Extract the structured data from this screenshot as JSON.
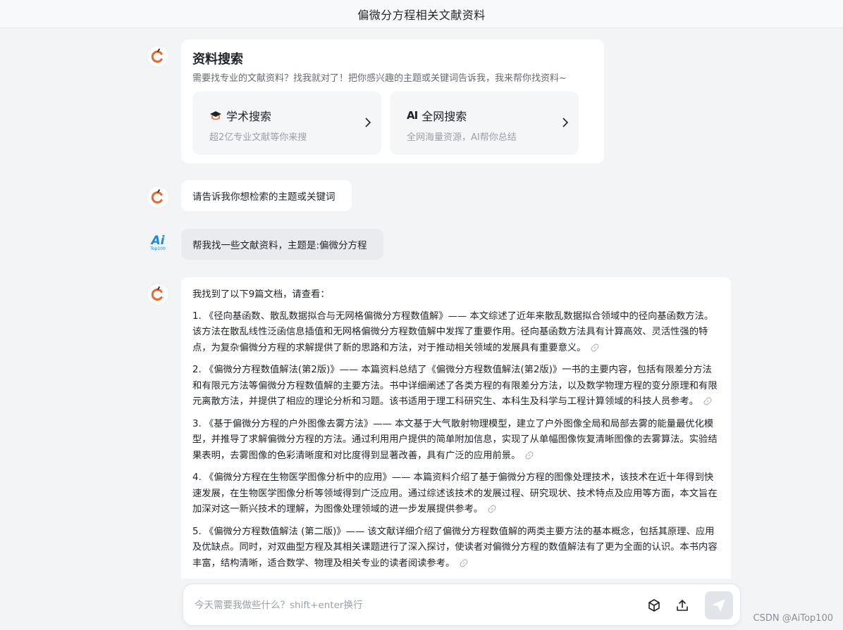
{
  "header": {
    "title": "偏微分方程相关文献资料"
  },
  "search_card": {
    "title": "资料搜索",
    "subtitle": "需要找专业的文献资料？找我就对了！把你感兴趣的主题或关键词告诉我，我来帮你找资料~",
    "options": [
      {
        "icon": "graduation-cap-icon",
        "title": "学术搜索",
        "desc": "超2亿专业文献等你来搜"
      },
      {
        "icon": "ai-icon",
        "icon_text": "AI",
        "title": "全网搜索",
        "desc": "全网海量资源，AI帮你总结"
      }
    ]
  },
  "messages": {
    "bot_prompt": "请告诉我你想检索的主题或关键词",
    "user_request": "帮我找一些文献资料，主题是:偏微分方程",
    "user_avatar_text": "Ai",
    "user_avatar_sub": "Top100"
  },
  "answer": {
    "intro": "我找到了以下9篇文档，请查看：",
    "items": [
      "1. 《径向基函数、散乱数据拟合与无网格偏微分方程数值解》—— 本文综述了近年来散乱数据拟合领域中的径向基函数方法。该方法在散乱线性泛函信息插值和无网格偏微分方程数值解中发挥了重要作用。径向基函数方法具有计算高效、灵活性强的特点，为复杂偏微分方程的求解提供了新的思路和方法，对于推动相关领域的发展具有重要意义。",
      "2. 《偏微分方程数值解法(第2版)》—— 本篇资料总结了《偏微分方程数值解法(第2版)》一书的主要内容，包括有限差分方法和有限元方法等偏微分方程数值解的主要方法。书中详细阐述了各类方程的有限差分方法，以及数学物理方程的变分原理和有限元离散方法，并提供了相应的理论分析和习题。该书适用于理工科研究生、本科生及科学与工程计算领域的科技人员参考。",
      "3. 《基于偏微分方程的户外图像去雾方法》—— 本文基于大气散射物理模型，建立了户外图像全局和局部去雾的能量最优化模型，并推导了求解偏微分方程的方法。通过利用用户提供的简单附加信息，实现了从单幅图像恢复清晰图像的去雾算法。实验结果表明，去雾图像的色彩清晰度和对比度得到显著改善，具有广泛的应用前景。",
      "4. 《偏微分方程在生物医学图像分析中的应用》—— 本篇资料介绍了基于偏微分方程的图像处理技术，该技术在近十年得到快速发展，在生物医学图像分析等领域得到广泛应用。通过综述该技术的发展过程、研究现状、技术特点及应用等方面，本文旨在加深对这一新兴技术的理解，为图像处理领域的进一步发展提供参考。",
      "5. 《偏微分方程数值解法 (第二版)》—— 该文献详细介绍了偏微分方程数值解的两类主要方法的基本概念，包括其原理、应用及优缺点。同时，对双曲型方程及其相关课题进行了深入探讨，使读者对偏微分方程的数值解法有了更为全面的认识。本书内容丰富，结构清晰，适合数学、物理及相关专业的读者阅读参考。"
    ]
  },
  "composer": {
    "placeholder": "今天需要我做些什么？shift+enter换行"
  },
  "watermark": "CSDN @AiTop100",
  "colors": {
    "brand_orange": "#f0642d",
    "background": "#f3f4f6",
    "user_bubble": "#e9ebef"
  }
}
